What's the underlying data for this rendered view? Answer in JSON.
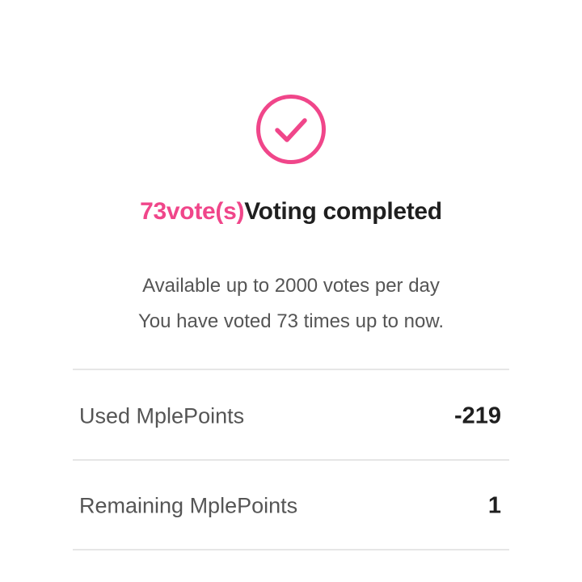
{
  "result": {
    "icon": "check-circle-icon",
    "accent_color": "#f0468a",
    "vote_count_label": "73vote(s)",
    "title_suffix": "Voting completed"
  },
  "description": {
    "line1": "Available up to 2000 votes per day",
    "line2": "You have voted 73 times up to now."
  },
  "points": [
    {
      "label": "Used MplePoints",
      "value": "-219"
    },
    {
      "label": "Remaining MplePoints",
      "value": "1"
    }
  ]
}
